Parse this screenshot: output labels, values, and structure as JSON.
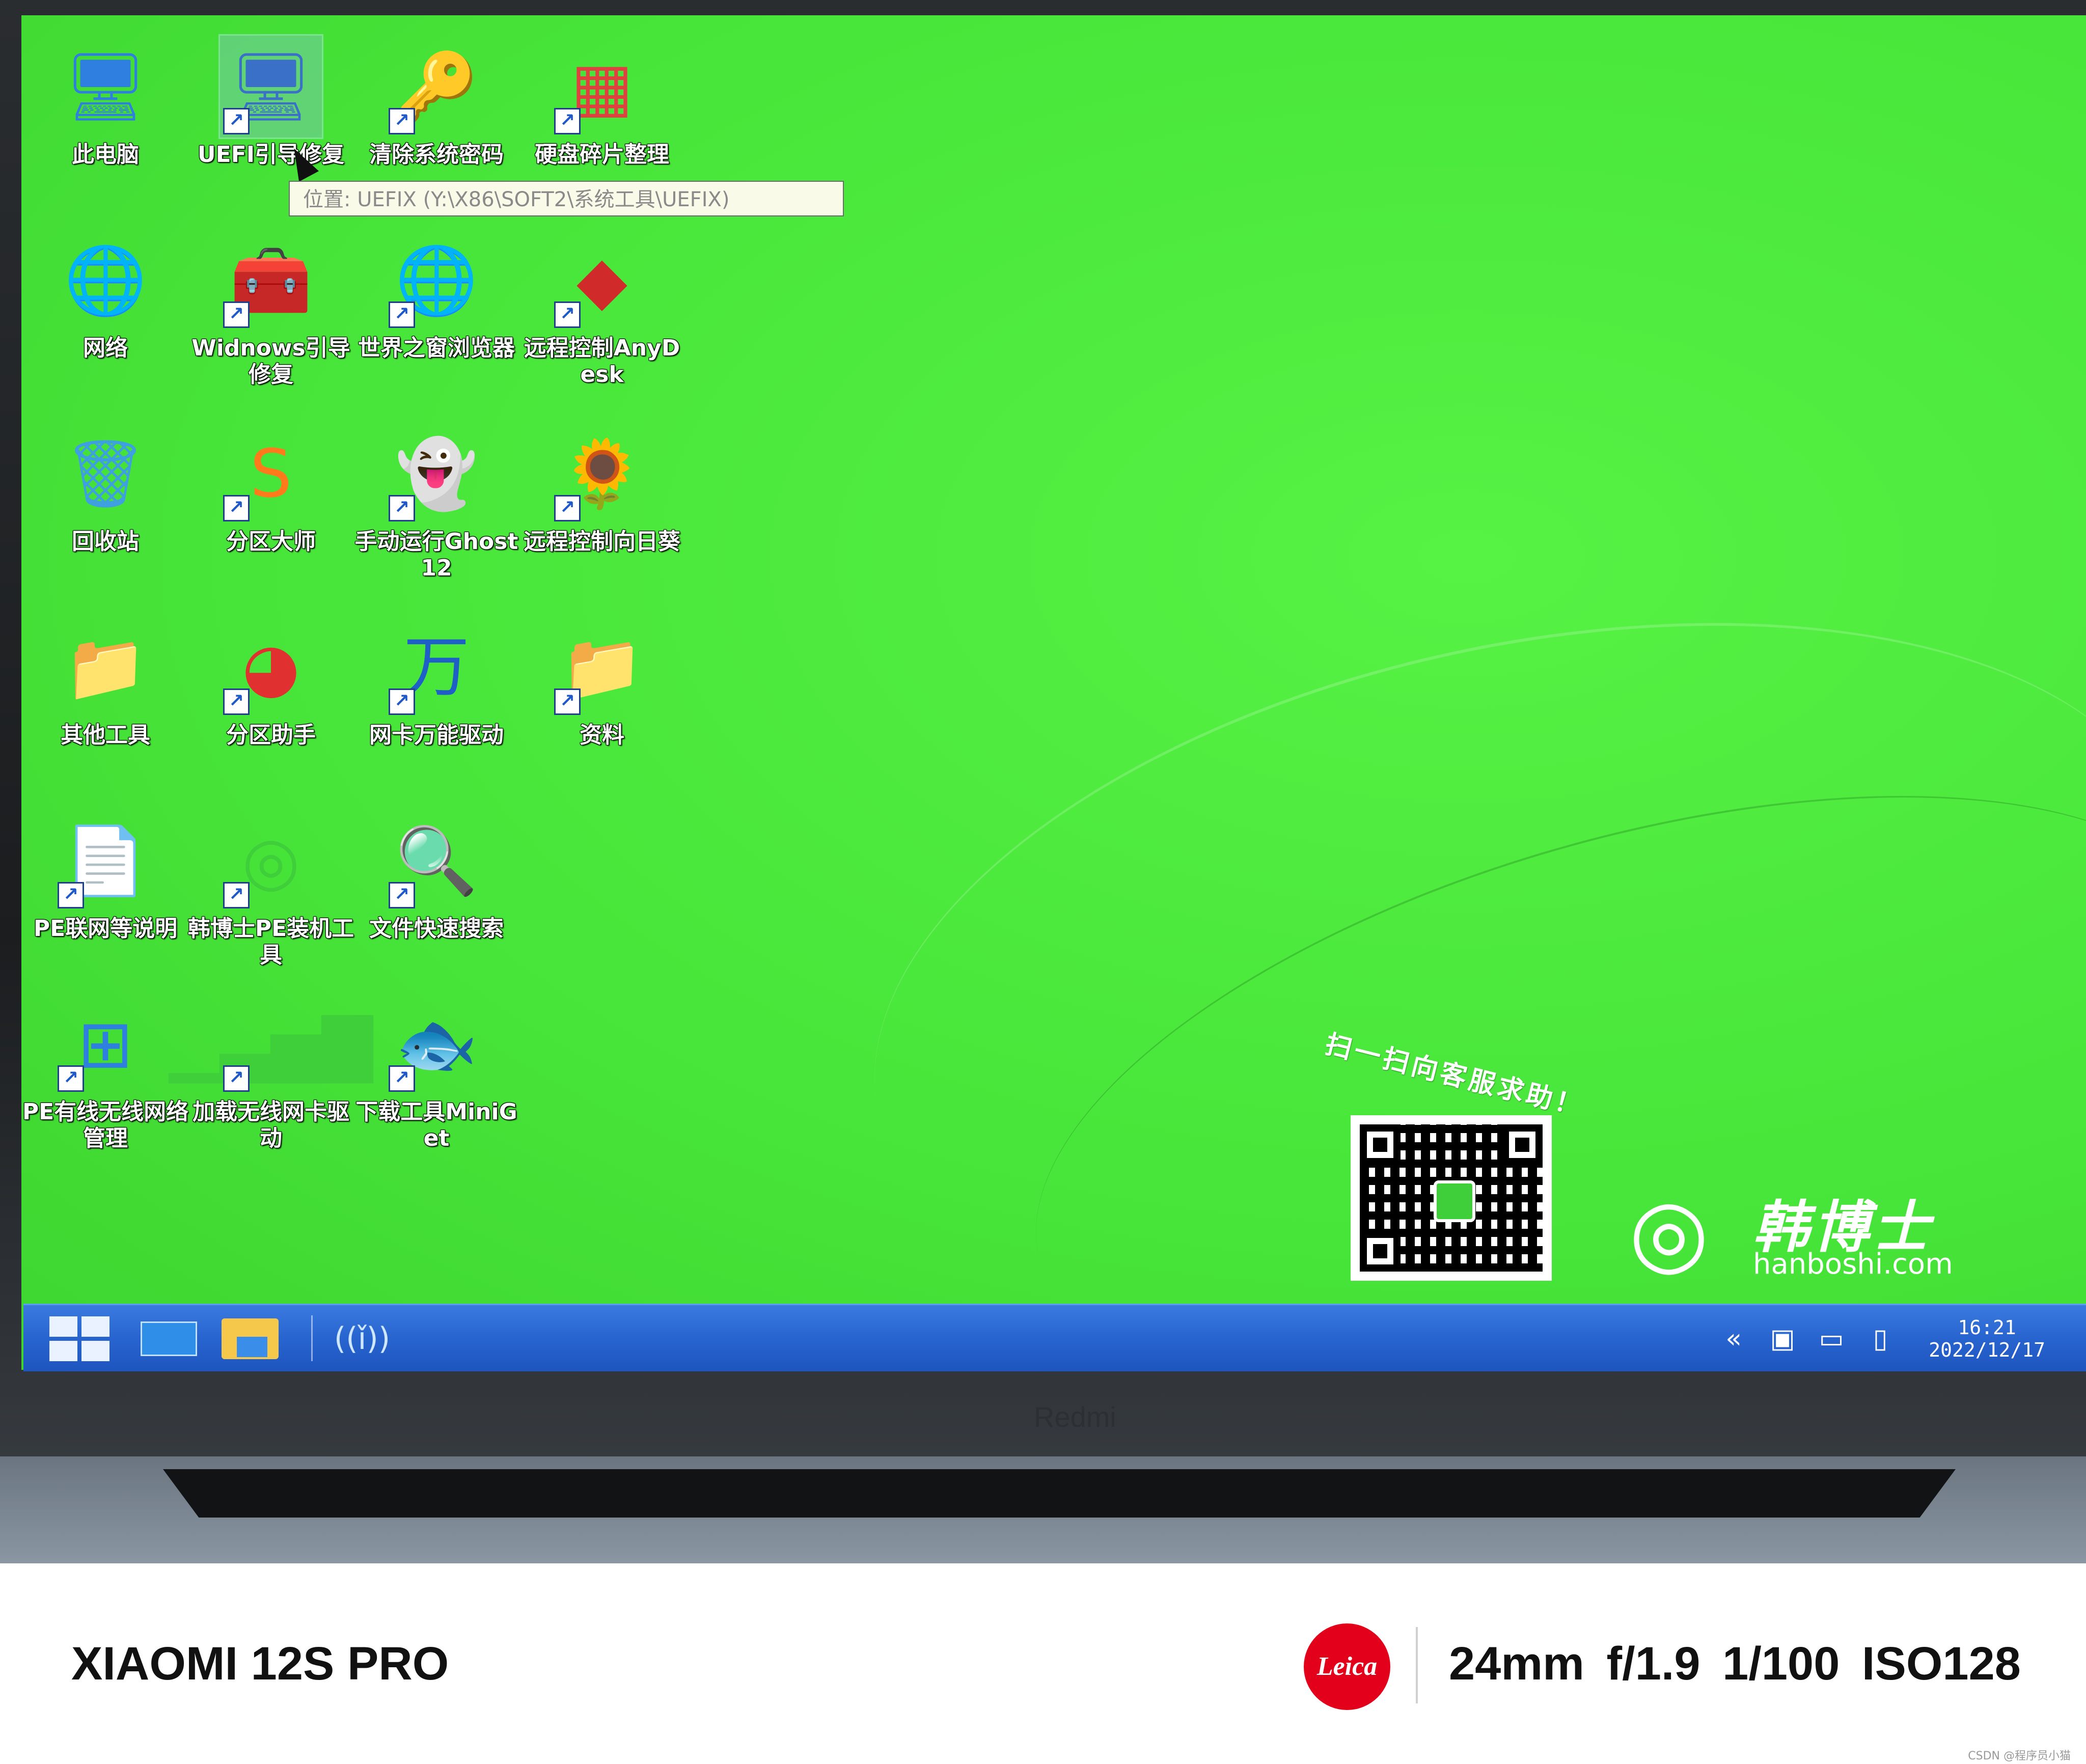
{
  "desktop": {
    "icons": [
      {
        "label": "此电脑",
        "glyph": "🖥",
        "color": "#2f7fe0"
      },
      {
        "label": "UEFI引导修复",
        "glyph": "🖥",
        "color": "#3a70c8"
      },
      {
        "label": "清除系统密码",
        "glyph": "🔑",
        "color": "#d02020"
      },
      {
        "label": "硬盘碎片整理",
        "glyph": "▦",
        "color": "#e04040"
      },
      {
        "label": "网络",
        "glyph": "🌐",
        "color": "#2f8fe8"
      },
      {
        "label": "Widnows引导修复",
        "glyph": "🧰",
        "color": "#d83030"
      },
      {
        "label": "世界之窗浏览器",
        "glyph": "🌐",
        "color": "#4a90e0"
      },
      {
        "label": "远程控制AnyDesk",
        "glyph": "◆",
        "color": "#d12a2a"
      },
      {
        "label": "回收站",
        "glyph": "🗑",
        "color": "#3fa0e0"
      },
      {
        "label": "分区大师",
        "glyph": "S",
        "color": "#ff7a1a"
      },
      {
        "label": "手动运行Ghost12",
        "glyph": "👻",
        "color": "#dff4ff"
      },
      {
        "label": "远程控制向日葵",
        "glyph": "🌻",
        "color": "#ff9a1a"
      },
      {
        "label": "其他工具",
        "glyph": "📁",
        "color": "#f5d77a"
      },
      {
        "label": "分区助手",
        "glyph": "◕",
        "color": "#e03030"
      },
      {
        "label": "网卡万能驱动",
        "glyph": "万",
        "color": "#1f5fc8"
      },
      {
        "label": "资料",
        "glyph": "📁",
        "color": "#f5e6a0"
      },
      {
        "label": "PE联网等说明",
        "glyph": "📄",
        "color": "#f2f2f2"
      },
      {
        "label": "韩博士PE装机工具",
        "glyph": "◎",
        "color": "#3fcf3a"
      },
      {
        "label": "文件快速搜索",
        "glyph": "🔍",
        "color": "#ff9a1a"
      },
      {
        "label": "",
        "glyph": "",
        "color": ""
      },
      {
        "label": "PE有线无线网络管理",
        "glyph": "⊞",
        "color": "#2f7fe0"
      },
      {
        "label": "加载无线网卡驱动",
        "glyph": "▁▃▅▇",
        "color": "#3fcf3a"
      },
      {
        "label": "下载工具MiniGet",
        "glyph": "🐟",
        "color": "#3a8de8"
      }
    ],
    "tooltip": "位置: UEFIX (Y:\\X86\\SOFT2\\系统工具\\UEFIX)",
    "qr_caption": "扫一扫向客服求助！",
    "brand_name": "韩博士",
    "brand_url": "hanboshi.com"
  },
  "taskbar": {
    "tray_chevron": "«",
    "time": "16:21",
    "date": "2022/12/17"
  },
  "bezel": {
    "brand": "Redmi"
  },
  "watermark": {
    "model": "XIAOMI 12S PRO",
    "logo": "Leica",
    "specs": "24mm  f/1.9  1/100  ISO128",
    "credit": "CSDN @程序员小猫"
  }
}
